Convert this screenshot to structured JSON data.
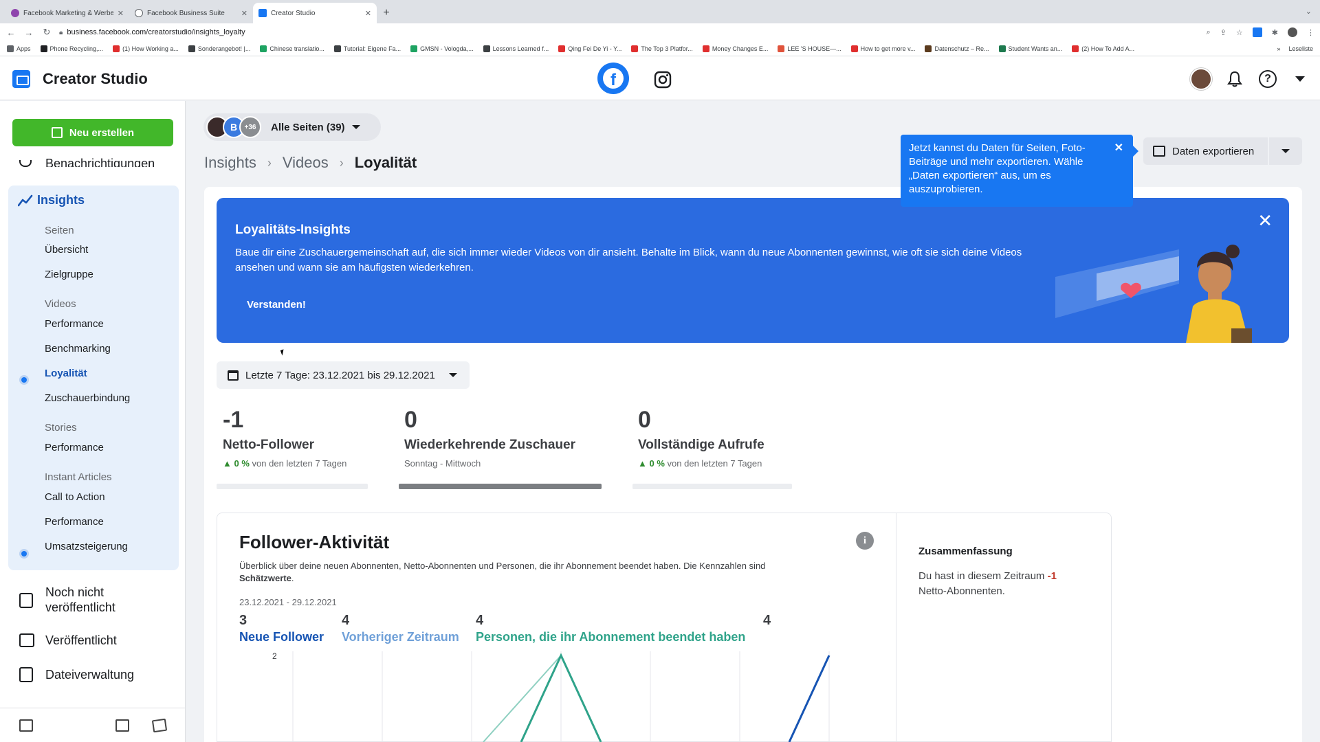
{
  "browser": {
    "tabs": [
      {
        "title": "Facebook Marketing & Werbea",
        "color": "#8e44ad"
      },
      {
        "title": "Facebook Business Suite",
        "color": "#5f6368"
      },
      {
        "title": "Creator Studio",
        "color": "#1877f2"
      }
    ],
    "url": "business.facebook.com/creatorstudio/insights_loyalty",
    "bookmarks": [
      {
        "label": "Apps",
        "color": "#5f6368"
      },
      {
        "label": "Phone Recycling,...",
        "color": "#202124"
      },
      {
        "label": "(1) How Working a...",
        "color": "#e02f2f"
      },
      {
        "label": "Sonderangebot! |...",
        "color": "#3c4043"
      },
      {
        "label": "Chinese translatio...",
        "color": "#1ea362"
      },
      {
        "label": "Tutorial: Eigene Fa...",
        "color": "#3c4043"
      },
      {
        "label": "GMSN - Vologda,...",
        "color": "#1ea362"
      },
      {
        "label": "Lessons Learned f...",
        "color": "#3c4043"
      },
      {
        "label": "Qing Fei De Yi - Y...",
        "color": "#e02f2f"
      },
      {
        "label": "The Top 3 Platfor...",
        "color": "#e02f2f"
      },
      {
        "label": "Money Changes E...",
        "color": "#e02f2f"
      },
      {
        "label": "LEE 'S HOUSE—...",
        "color": "#e0533b"
      },
      {
        "label": "How to get more v...",
        "color": "#e02f2f"
      },
      {
        "label": "Datenschutz – Re...",
        "color": "#5b3b1e"
      },
      {
        "label": "Student Wants an...",
        "color": "#1e7a4f"
      },
      {
        "label": "(2) How To Add A...",
        "color": "#e02f2f"
      }
    ],
    "reading_list": "Leseliste"
  },
  "header": {
    "title": "Creator Studio"
  },
  "sidebar": {
    "create_label": "Neu erstellen",
    "cut_item": "Benachrichtigungen",
    "insights_label": "Insights",
    "groups": {
      "pages": "Seiten",
      "videos": "Videos",
      "stories": "Stories",
      "instant_articles": "Instant Articles"
    },
    "items": {
      "overview": "Übersicht",
      "audience": "Zielgruppe",
      "video_performance": "Performance",
      "benchmarking": "Benchmarking",
      "loyalty": "Loyalität",
      "retention": "Zuschauerbindung",
      "stories_performance": "Performance",
      "call_to_action": "Call to Action",
      "ia_performance": "Performance",
      "monetization": "Umsatzsteigerung"
    },
    "main": {
      "unpublished": "Noch nicht veröffentlicht",
      "published": "Veröffentlicht",
      "files": "Dateiverwaltung"
    }
  },
  "pages_selector": {
    "avatar_b": "B",
    "more_count": "+36",
    "label": "Alle Seiten (39)"
  },
  "breadcrumb": {
    "root": "Insights",
    "mid": "Videos",
    "current": "Loyalität"
  },
  "tooltip": {
    "text": "Jetzt kannst du Daten für Seiten, Foto-Beiträge und mehr exportieren. Wähle „Daten exportieren“ aus, um es auszuprobieren."
  },
  "export": {
    "label": "Daten exportieren"
  },
  "banner": {
    "title": "Loyalitäts-Insights",
    "text": "Baue dir eine Zuschauergemeinschaft auf, die sich immer wieder Videos von dir ansieht. Behalte im Blick, wann du neue Abonnenten gewinnst, wie oft sie sich deine Videos ansehen und wann sie am häufigsten wiederkehren.",
    "button": "Verstanden!"
  },
  "date_range": {
    "label": "Letzte 7 Tage: 23.12.2021 bis 29.12.2021"
  },
  "metrics": [
    {
      "value": "-1",
      "label": "Netto-Follower",
      "change": "0 %",
      "sub": "von den letzten 7 Tagen"
    },
    {
      "value": "0",
      "label": "Wiederkehrende Zuschauer",
      "sub": "Sonntag - Mittwoch"
    },
    {
      "value": "0",
      "label": "Vollständige Aufrufe",
      "change": "0 %",
      "sub": "von den letzten 7 Tagen"
    }
  ],
  "follower_activity": {
    "title": "Follower-Aktivität",
    "info": "i",
    "desc_main": "Überblick über deine neuen Abonnenten, Netto-Abonnenten und Personen, die ihr Abonnement beendet haben. Die Kennzahlen sind",
    "desc_bold": "Schätzwerte",
    "desc_end": ".",
    "range": "23.12.2021 - 29.12.2021",
    "legend": [
      {
        "value": "3",
        "name": "Neue Follower",
        "color": "#1654b3"
      },
      {
        "value": "4",
        "name": "Vorheriger Zeitraum",
        "color": "#6fa0d8"
      },
      {
        "value": "4",
        "name": "Personen, die ihr Abonnement beendet haben",
        "color": "#2fa38a"
      },
      {
        "value": "4",
        "name": "",
        "color": "#3c3e42"
      }
    ],
    "y_tick": "2"
  },
  "summary": {
    "title": "Zusammenfassung",
    "text_before": "Du hast in diesem Zeitraum",
    "value": "-1",
    "text_after": "Netto-Abonnenten."
  },
  "colors": {
    "accent": "#1877f2",
    "create": "#42b72a",
    "banner": "#2b6be0"
  }
}
